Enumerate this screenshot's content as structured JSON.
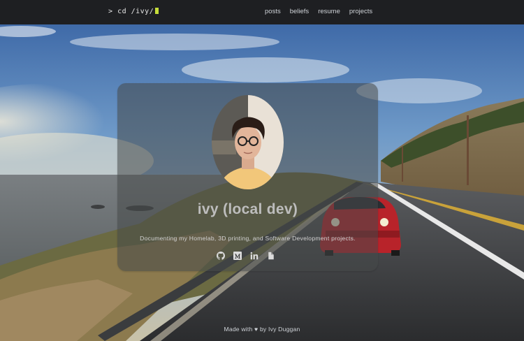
{
  "navbar": {
    "brand_prompt": ">",
    "brand_text": "cd /ivy/",
    "links": [
      {
        "label": "posts"
      },
      {
        "label": "beliefs"
      },
      {
        "label": "resume"
      },
      {
        "label": "projects"
      }
    ]
  },
  "hero": {
    "name": "ivy (local dev)",
    "tagline": "Documenting my Homelab, 3D printing, and Software Development projects.",
    "socials": [
      {
        "icon": "github-icon"
      },
      {
        "icon": "medium-icon"
      },
      {
        "icon": "linkedin-icon"
      },
      {
        "icon": "blog-icon"
      }
    ]
  },
  "footer": {
    "text_before": "Made with",
    "heart": "♥",
    "text_after": "by Ivy Duggan"
  },
  "colors": {
    "navbar_bg": "#1e1f22",
    "cursor": "#c6dd3a",
    "card_bg": "rgba(70,72,72,0.55)"
  }
}
